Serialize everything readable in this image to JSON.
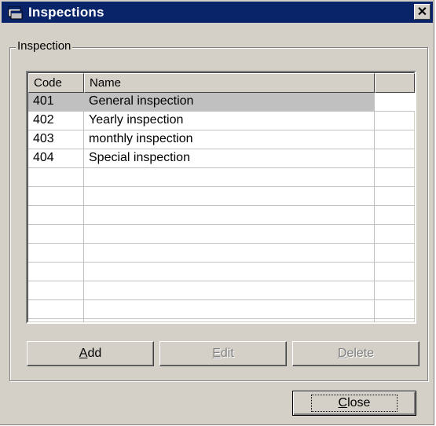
{
  "window": {
    "title": "Inspections",
    "close_glyph": "✕",
    "title_icon": "app-window-icon"
  },
  "group": {
    "label": "Inspection"
  },
  "grid": {
    "columns": [
      "Code",
      "Name",
      ""
    ],
    "rows": [
      {
        "code": "401",
        "name": "General inspection",
        "selected": true
      },
      {
        "code": "402",
        "name": "Yearly inspection",
        "selected": false
      },
      {
        "code": "403",
        "name": "monthly inspection",
        "selected": false
      },
      {
        "code": "404",
        "name": "Special inspection",
        "selected": false
      }
    ],
    "empty_rows": 8
  },
  "buttons": {
    "add": {
      "label": "Add",
      "mnemonic": "A",
      "rest": "dd",
      "enabled": true
    },
    "edit": {
      "label": "Edit",
      "mnemonic": "E",
      "rest": "dit",
      "enabled": false
    },
    "delete": {
      "label": "Delete",
      "mnemonic": "D",
      "rest": "elete",
      "enabled": false
    },
    "close": {
      "label": "Close",
      "mnemonic": "C",
      "rest": "lose",
      "enabled": true
    }
  },
  "colors": {
    "titlebar": "#0a246a",
    "face": "#d4d0c8",
    "selection": "#c0c0c0"
  }
}
